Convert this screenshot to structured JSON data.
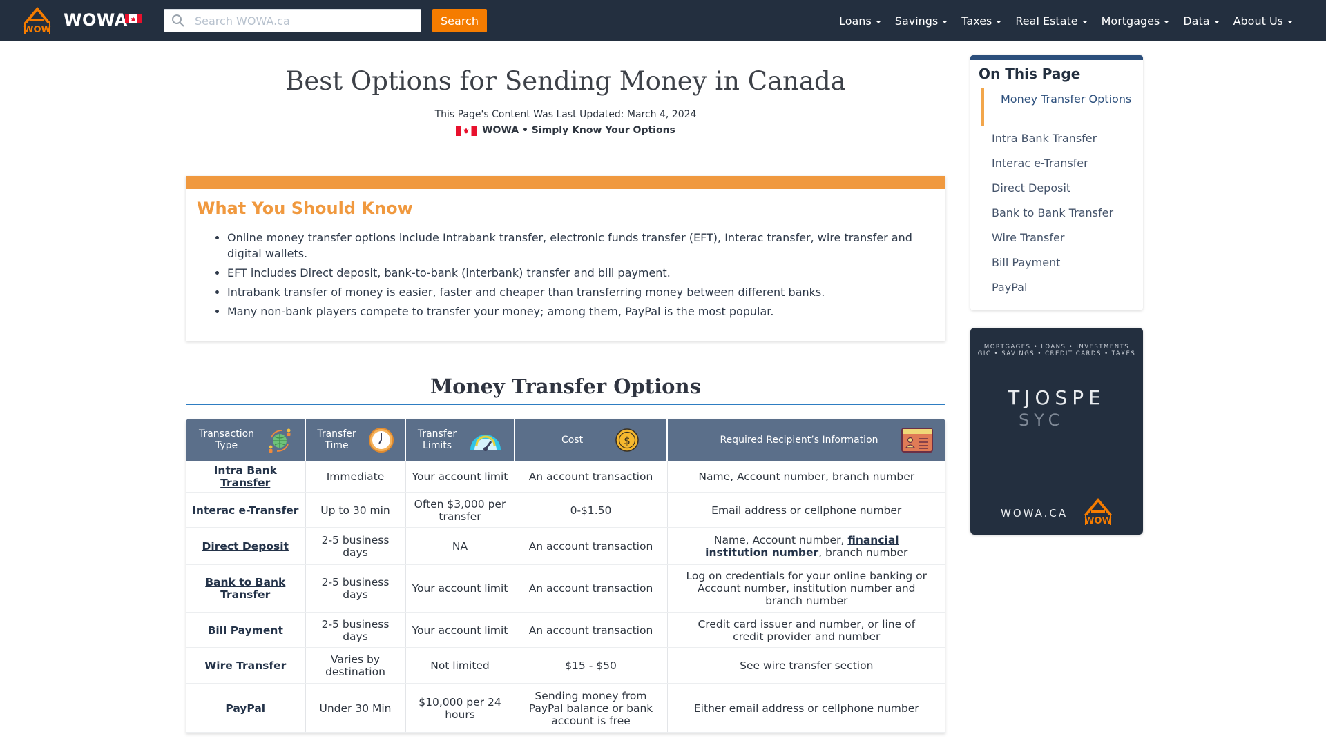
{
  "nav": {
    "brand": "WOWA",
    "search_placeholder": "Search WOWA.ca",
    "search_value": "",
    "search_button": "Search",
    "menu": [
      {
        "label": "Loans"
      },
      {
        "label": "Savings"
      },
      {
        "label": "Taxes"
      },
      {
        "label": "Real Estate"
      },
      {
        "label": "Mortgages"
      },
      {
        "label": "Data"
      },
      {
        "label": "About Us"
      }
    ]
  },
  "header": {
    "title": "Best Options for Sending Money in Canada",
    "updated": "This Page's Content Was Last Updated: March 4, 2024",
    "tagline": "WOWA • Simply Know Your Options"
  },
  "know": {
    "title": "What You Should Know",
    "bullets": [
      "Online money transfer options include Intrabank transfer, electronic funds transfer (EFT), Interac transfer, wire transfer and digital wallets.",
      "EFT includes Direct deposit, bank-to-bank (interbank) transfer and bill payment.",
      "Intrabank transfer of money is easier, faster and cheaper than transferring money between different banks.",
      "Many non-bank players compete to transfer your money; among them, PayPal is the most popular."
    ]
  },
  "section": {
    "title": "Money Transfer Options"
  },
  "table": {
    "headers": [
      {
        "label": "Transaction Type",
        "icon": "globe-transfer-icon"
      },
      {
        "label": "Transfer Time",
        "icon": "clock-icon"
      },
      {
        "label": "Transfer Limits",
        "icon": "speedometer-icon"
      },
      {
        "label": "Cost",
        "icon": "dollar-coin-icon"
      },
      {
        "label": "Required Recipient’s Information",
        "icon": "id-card-icon"
      }
    ],
    "rows": [
      {
        "type": "Intra Bank Transfer",
        "time": "Immediate",
        "limits": "Your account limit",
        "cost": "An account transaction",
        "info_pre": "Name, Account number, branch number",
        "info_link": "",
        "info_post": ""
      },
      {
        "type": "Interac e-Transfer",
        "time": "Up to 30 min",
        "limits": "Often $3,000 per transfer",
        "cost": "0-$1.50",
        "info_pre": "Email address or cellphone number",
        "info_link": "",
        "info_post": ""
      },
      {
        "type": "Direct Deposit",
        "time": "2-5 business days",
        "limits": "NA",
        "cost": "An account transaction",
        "info_pre": "Name, Account number, ",
        "info_link": "financial institution number",
        "info_post": ", branch number"
      },
      {
        "type": "Bank to Bank Transfer",
        "time": "2-5 business days",
        "limits": "Your account limit",
        "cost": "An account transaction",
        "info_pre": "Log on credentials for your online banking or Account number, institution number and branch number",
        "info_link": "",
        "info_post": ""
      },
      {
        "type": "Bill Payment",
        "time": "2-5 business days",
        "limits": "Your account limit",
        "cost": "An account transaction",
        "info_pre": "Credit card issuer and number, or line of credit provider and number",
        "info_link": "",
        "info_post": ""
      },
      {
        "type": "Wire Transfer",
        "time": "Varies by destination",
        "limits": "Not limited",
        "cost": "$15 - $50",
        "info_pre": "See wire transfer section",
        "info_link": "",
        "info_post": ""
      },
      {
        "type": "PayPal",
        "time": "Under 30 Min",
        "limits": "$10,000 per 24 hours",
        "cost": "Sending money from PayPal balance or bank account is free",
        "info_pre": "Either email address or cellphone number",
        "info_link": "",
        "info_post": ""
      }
    ]
  },
  "toc": {
    "title": "On This Page",
    "items": [
      {
        "label": "Money Transfer Options",
        "active": true
      },
      {
        "label": "Intra Bank Transfer"
      },
      {
        "label": "Interac e-Transfer"
      },
      {
        "label": "Direct Deposit"
      },
      {
        "label": "Bank to Bank Transfer"
      },
      {
        "label": "Wire Transfer"
      },
      {
        "label": "Bill Payment"
      },
      {
        "label": "PayPal"
      }
    ]
  },
  "ad": {
    "categories_line1": "MORTGAGES • LOANS • INVESTMENTS",
    "categories_line2": "GIC • SAVINGS • CREDIT CARDS • TAXES",
    "big_text": "TJOSPE",
    "big_text2": "SYC",
    "site": "WOWA.CA"
  },
  "colors": {
    "nav_bg": "#232f3f",
    "accent_orange": "#f57c00",
    "know_orange": "#f0993f",
    "table_header": "#5b6f8a",
    "section_rule": "#2e7dc2",
    "toc_bar": "#2c4f7c"
  }
}
